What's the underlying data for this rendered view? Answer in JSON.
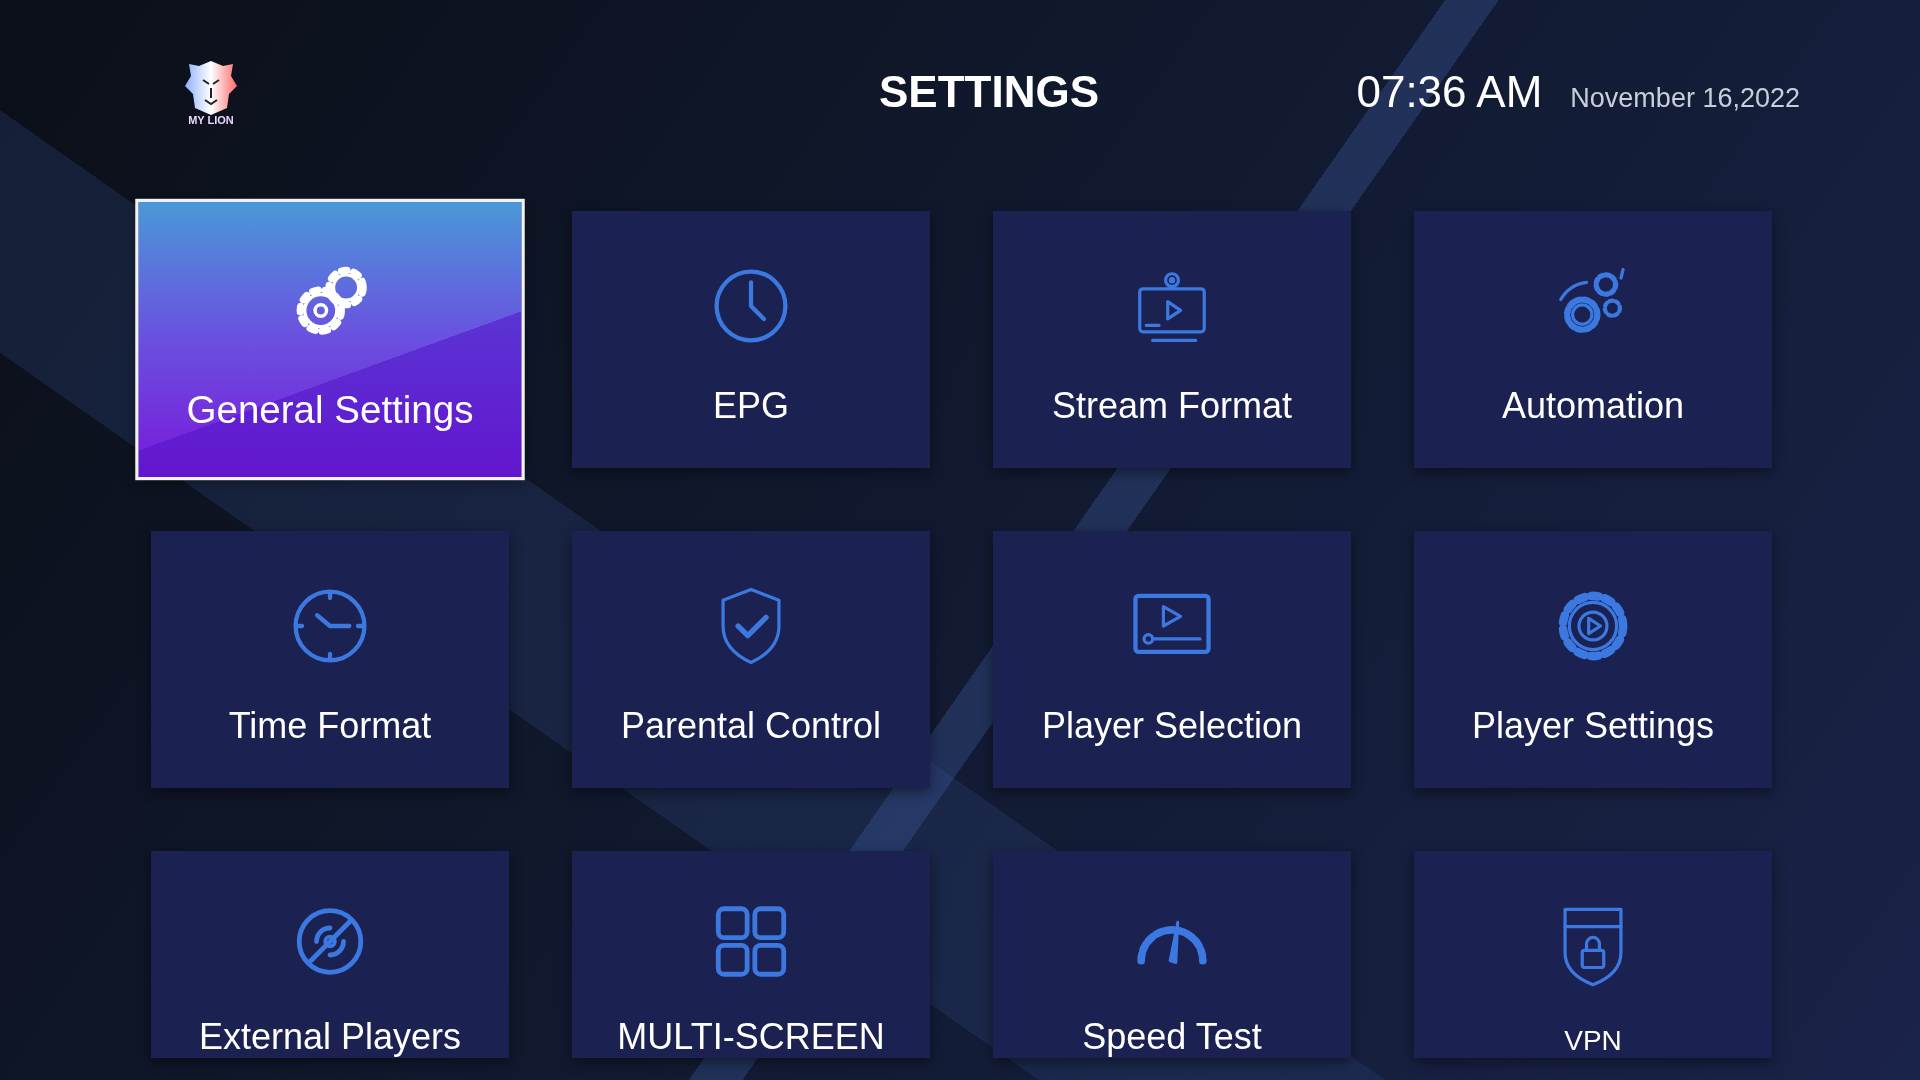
{
  "logo": {
    "text": "MY LION"
  },
  "title": "SETTINGS",
  "clock": {
    "time": "07:36 AM",
    "date": "November 16,2022"
  },
  "tiles": [
    {
      "label": "General Settings",
      "selected": true
    },
    {
      "label": "EPG",
      "selected": false
    },
    {
      "label": "Stream Format",
      "selected": false
    },
    {
      "label": "Automation",
      "selected": false
    },
    {
      "label": "Time Format",
      "selected": false
    },
    {
      "label": "Parental Control",
      "selected": false
    },
    {
      "label": "Player Selection",
      "selected": false
    },
    {
      "label": "Player Settings",
      "selected": false
    },
    {
      "label": "External Players",
      "selected": false
    },
    {
      "label": "MULTI-SCREEN",
      "selected": false
    },
    {
      "label": "Speed Test",
      "selected": false
    },
    {
      "label": "VPN",
      "selected": false
    }
  ]
}
